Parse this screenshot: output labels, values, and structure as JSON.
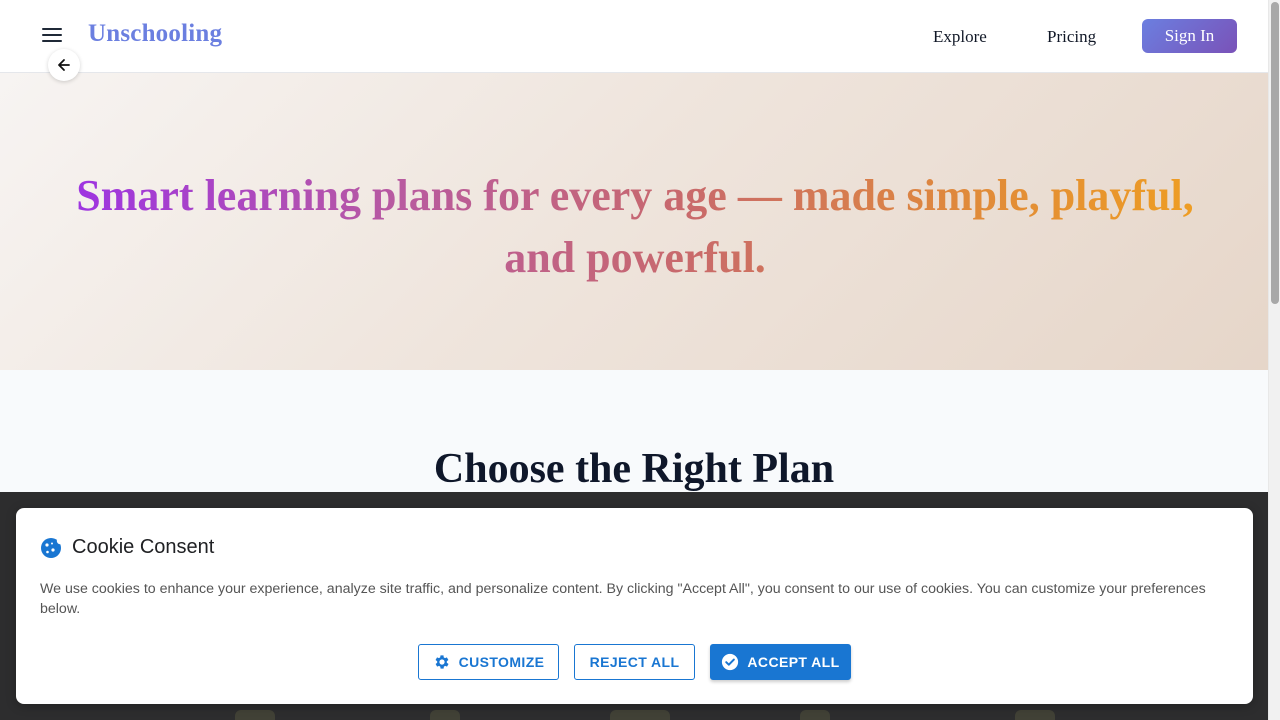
{
  "header": {
    "logo": "Unschooling",
    "nav": {
      "explore": "Explore",
      "pricing": "Pricing"
    },
    "signin_label": "Sign In"
  },
  "hero": {
    "title": "Smart learning plans for every age — made simple, playful, and powerful."
  },
  "plans": {
    "title": "Choose the Right Plan"
  },
  "cookie": {
    "title": "Cookie Consent",
    "text": "We use cookies to enhance your experience, analyze site traffic, and personalize content. By clicking \"Accept All\", you consent to our use of cookies. You can customize your preferences below.",
    "customize_label": "CUSTOMIZE",
    "reject_label": "REJECT ALL",
    "accept_label": "ACCEPT ALL"
  },
  "icons": {
    "menu": "hamburger-menu-icon",
    "back": "arrow-left-icon",
    "cookie": "cookie-icon",
    "customize": "gear-icon",
    "accept": "check-circle-icon"
  },
  "colors": {
    "brand": "#6b7fe0",
    "signin_gradient_end": "#7a52b8",
    "cookie_accent": "#1976d2",
    "hero_gradient": [
      "#9b30e8",
      "#c96a6a",
      "#f0a020"
    ]
  }
}
